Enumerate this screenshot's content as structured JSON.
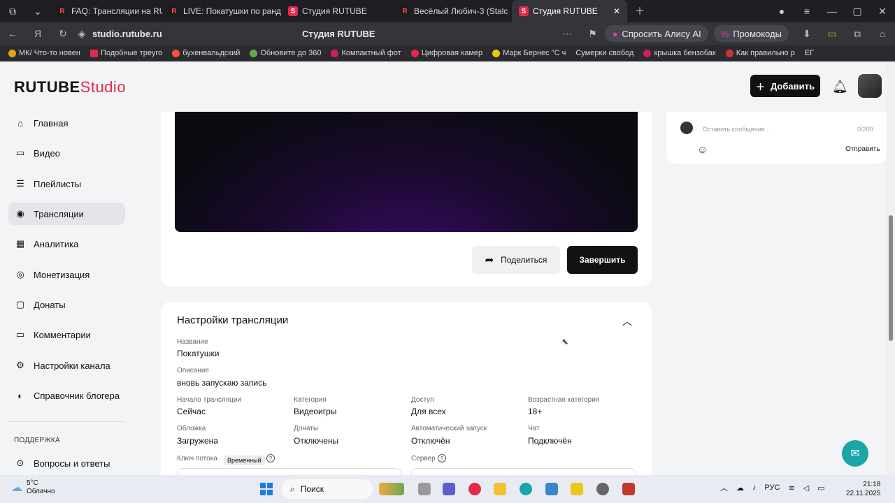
{
  "browser": {
    "tabs": [
      {
        "label": "FAQ: Трансляции на RUT",
        "favicon": "R"
      },
      {
        "label": "LIVE: Покатушки по ранд",
        "favicon": "R"
      },
      {
        "label": "Студия RUTUBE",
        "favicon": "S"
      },
      {
        "label": "Весёлый Любич-3 (Stalc",
        "favicon": "R"
      },
      {
        "label": "Студия RUTUBE",
        "favicon": "S",
        "active": true
      }
    ],
    "url": "studio.rutube.ru",
    "page_title": "Студия RUTUBE",
    "alice_label": "Спросить Алису AI",
    "promo_label": "Промокоды",
    "bookmarks": [
      "МК/ Что-то новен",
      "Подобные треуго",
      "бухенвальдский",
      "Обновите до 360",
      "Компактный фот",
      "Цифровая камер",
      "Марк Бернес \"С ч",
      "Сумерки свобод",
      "крышка бензобак",
      "Как правильно р",
      "ЕГ"
    ]
  },
  "header": {
    "logo_main": "RUTUBE",
    "logo_studio": "Studio",
    "add_label": "Добавить"
  },
  "sidebar": {
    "items": [
      {
        "label": "Главная",
        "icon": "home-icon"
      },
      {
        "label": "Видео",
        "icon": "video-icon"
      },
      {
        "label": "Плейлисты",
        "icon": "playlist-icon"
      },
      {
        "label": "Трансляции",
        "icon": "broadcast-icon",
        "active": true
      },
      {
        "label": "Аналитика",
        "icon": "analytics-icon"
      },
      {
        "label": "Монетизация",
        "icon": "money-icon"
      },
      {
        "label": "Донаты",
        "icon": "donate-icon"
      },
      {
        "label": "Комментарии",
        "icon": "comments-icon"
      },
      {
        "label": "Настройки канала",
        "icon": "gear-icon"
      },
      {
        "label": "Справочник блогера",
        "icon": "book-icon"
      }
    ],
    "support_section": "ПОДДЕРЖКА",
    "support_items": [
      {
        "label": "Вопросы и ответы",
        "icon": "question-icon"
      }
    ]
  },
  "stream": {
    "share_label": "Поделиться",
    "finish_label": "Завершить"
  },
  "settings": {
    "title": "Настройки трансляции",
    "name_label": "Название",
    "name_value": "Покатушки",
    "desc_label": "Описание",
    "desc_value": "вновь запускаю запись",
    "grid": [
      {
        "label": "Начало трансляции",
        "value": "Сейчас"
      },
      {
        "label": "Категория",
        "value": "Видеоигры"
      },
      {
        "label": "Доступ",
        "value": "Для всех"
      },
      {
        "label": "Возрастная категория",
        "value": "18+"
      },
      {
        "label": "Обложка",
        "value": "Загружена"
      },
      {
        "label": "Донаты",
        "value": "Отключены"
      },
      {
        "label": "Автоматический запуск",
        "value": "Отключён"
      },
      {
        "label": "Чат",
        "value": "Подключён"
      }
    ],
    "stream_key_label": "Ключ потока",
    "stream_key_badge": "Временный",
    "server_label": "Сервер"
  },
  "chat": {
    "placeholder": "Оставить сообщение...",
    "counter": "0/200",
    "send_label": "Отправить"
  },
  "taskbar": {
    "temp": "5°C",
    "weather": "Облачно",
    "search_label": "Поиск",
    "lang": "РУС",
    "time": "21:18",
    "date": "22.11.2025"
  }
}
